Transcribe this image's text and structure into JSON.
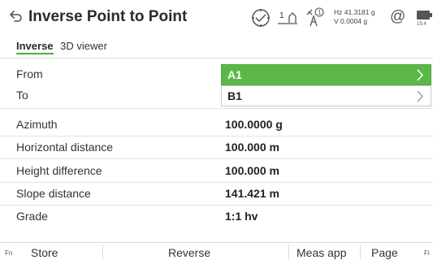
{
  "header": {
    "title": "Inverse Point to Point",
    "prism_number": "1",
    "hz": "Hz 41.3181 g",
    "v": "V  0.0004 g",
    "clock": "15:4"
  },
  "tabs": [
    {
      "label": "Inverse",
      "active": true
    },
    {
      "label": "3D viewer",
      "active": false
    }
  ],
  "fields": {
    "from": {
      "label": "From",
      "value": "A1"
    },
    "to": {
      "label": "To",
      "value": "B1"
    }
  },
  "results": [
    {
      "label": "Azimuth",
      "value": "100.0000 g"
    },
    {
      "label": "Horizontal distance",
      "value": "100.000 m"
    },
    {
      "label": "Height difference",
      "value": "100.000 m"
    },
    {
      "label": "Slope distance",
      "value": "141.421 m"
    },
    {
      "label": "Grade",
      "value": "1:1 hv"
    }
  ],
  "function_bar": {
    "fn_left": "Fn",
    "store": "Store",
    "reverse": "Reverse",
    "meas_app": "Meas app",
    "page": "Page",
    "fn_right": "Fi"
  },
  "colors": {
    "accent_green": "#5cb846",
    "tab_underline": "#4caf3a"
  },
  "icons": [
    "back-icon",
    "target-icon",
    "prism-icon",
    "satellite-icon",
    "at-icon",
    "battery-icon",
    "chevron-right-icon"
  ]
}
